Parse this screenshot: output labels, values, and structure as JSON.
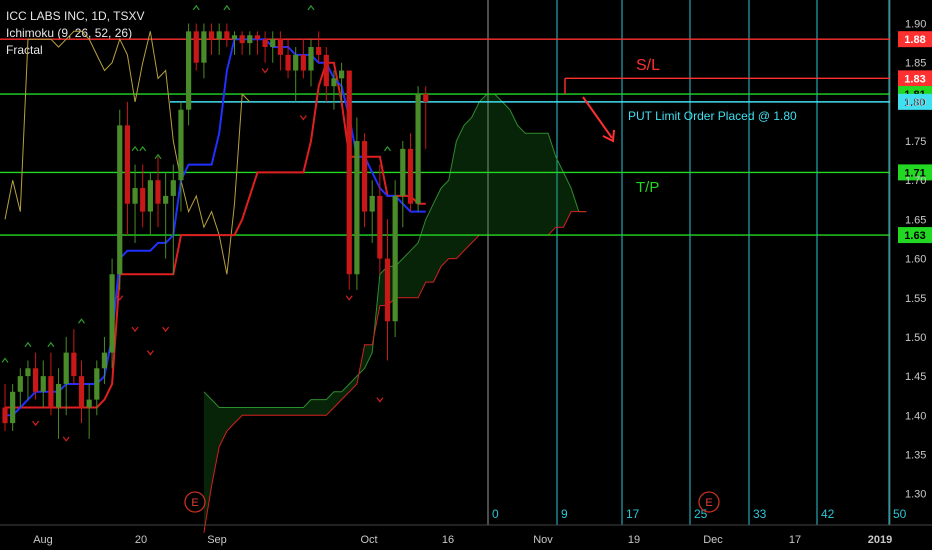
{
  "chart_data": {
    "type": "candlestick",
    "symbol_line": "ICC LABS INC, 1D, TSXV",
    "indicators": [
      "Ichimoku (9, 26, 52, 26)",
      "Fractal"
    ],
    "y_range": [
      1.26,
      1.93
    ],
    "y_ticks": [
      {
        "v": 1.9,
        "label": "1.90"
      },
      {
        "v": 1.85,
        "label": "1.85"
      },
      {
        "v": 1.8,
        "label": "1.80"
      },
      {
        "v": 1.75,
        "label": "1.75"
      },
      {
        "v": 1.7,
        "label": "1.70"
      },
      {
        "v": 1.65,
        "label": "1.65"
      },
      {
        "v": 1.6,
        "label": "1.60"
      },
      {
        "v": 1.55,
        "label": "1.55"
      },
      {
        "v": 1.5,
        "label": "1.50"
      },
      {
        "v": 1.45,
        "label": "1.45"
      },
      {
        "v": 1.4,
        "label": "1.40"
      },
      {
        "v": 1.35,
        "label": "1.35"
      },
      {
        "v": 1.3,
        "label": "1.30"
      }
    ],
    "x_labels": [
      "Aug",
      "20",
      "Sep",
      "Oct",
      "16",
      "Nov",
      "19",
      "Dec",
      "17",
      "2019"
    ],
    "bar_count_markers": [
      "0",
      "9",
      "17",
      "25",
      "33",
      "42",
      "50"
    ],
    "earnings_markers": [
      "E",
      "E"
    ],
    "horizontal_levels": [
      {
        "price": 1.88,
        "label": "1.88",
        "color": "#ff3030"
      },
      {
        "price": 1.83,
        "label": "1.83",
        "color": "#ff3030"
      },
      {
        "price": 1.81,
        "label": "1.81",
        "color": "#22d822"
      },
      {
        "price": 1.8,
        "label": "1.80",
        "color": "#40e0f0"
      },
      {
        "price": 1.71,
        "label": "1.71",
        "color": "#22d822"
      },
      {
        "price": 1.63,
        "label": "1.63",
        "color": "#22d822"
      }
    ],
    "annotations": [
      {
        "text": "S/L",
        "color": "#ff3030"
      },
      {
        "text": "PUT Limit Order Placed @ 1.80",
        "color": "#40e0f0"
      },
      {
        "text": "T/P",
        "color": "#22d822"
      }
    ],
    "candles": [
      {
        "o": 1.41,
        "h": 1.44,
        "l": 1.38,
        "c": 1.39
      },
      {
        "o": 1.39,
        "h": 1.44,
        "l": 1.38,
        "c": 1.43
      },
      {
        "o": 1.43,
        "h": 1.46,
        "l": 1.41,
        "c": 1.45
      },
      {
        "o": 1.45,
        "h": 1.47,
        "l": 1.42,
        "c": 1.46
      },
      {
        "o": 1.46,
        "h": 1.48,
        "l": 1.42,
        "c": 1.43
      },
      {
        "o": 1.43,
        "h": 1.47,
        "l": 1.41,
        "c": 1.45
      },
      {
        "o": 1.45,
        "h": 1.48,
        "l": 1.4,
        "c": 1.41
      },
      {
        "o": 1.41,
        "h": 1.46,
        "l": 1.37,
        "c": 1.44
      },
      {
        "o": 1.44,
        "h": 1.5,
        "l": 1.4,
        "c": 1.48
      },
      {
        "o": 1.48,
        "h": 1.51,
        "l": 1.44,
        "c": 1.45
      },
      {
        "o": 1.45,
        "h": 1.47,
        "l": 1.39,
        "c": 1.41
      },
      {
        "o": 1.41,
        "h": 1.44,
        "l": 1.37,
        "c": 1.42
      },
      {
        "o": 1.42,
        "h": 1.47,
        "l": 1.4,
        "c": 1.46
      },
      {
        "o": 1.46,
        "h": 1.5,
        "l": 1.44,
        "c": 1.48
      },
      {
        "o": 1.48,
        "h": 1.6,
        "l": 1.46,
        "c": 1.58
      },
      {
        "o": 1.58,
        "h": 1.79,
        "l": 1.56,
        "c": 1.77
      },
      {
        "o": 1.77,
        "h": 1.8,
        "l": 1.63,
        "c": 1.67
      },
      {
        "o": 1.67,
        "h": 1.72,
        "l": 1.62,
        "c": 1.69
      },
      {
        "o": 1.69,
        "h": 1.72,
        "l": 1.64,
        "c": 1.66
      },
      {
        "o": 1.66,
        "h": 1.71,
        "l": 1.63,
        "c": 1.7
      },
      {
        "o": 1.7,
        "h": 1.73,
        "l": 1.64,
        "c": 1.67
      },
      {
        "o": 1.67,
        "h": 1.71,
        "l": 1.6,
        "c": 1.68
      },
      {
        "o": 1.68,
        "h": 1.72,
        "l": 1.58,
        "c": 1.7
      },
      {
        "o": 1.7,
        "h": 1.8,
        "l": 1.66,
        "c": 1.79
      },
      {
        "o": 1.79,
        "h": 1.9,
        "l": 1.77,
        "c": 1.89
      },
      {
        "o": 1.89,
        "h": 1.9,
        "l": 1.84,
        "c": 1.85
      },
      {
        "o": 1.85,
        "h": 1.9,
        "l": 1.83,
        "c": 1.89
      },
      {
        "o": 1.89,
        "h": 1.9,
        "l": 1.86,
        "c": 1.88
      },
      {
        "o": 1.88,
        "h": 1.9,
        "l": 1.86,
        "c": 1.89
      },
      {
        "o": 1.89,
        "h": 1.9,
        "l": 1.87,
        "c": 1.88
      },
      {
        "o": 1.88,
        "h": 1.89,
        "l": 1.86,
        "c": 1.885
      },
      {
        "o": 1.885,
        "h": 1.89,
        "l": 1.86,
        "c": 1.875
      },
      {
        "o": 1.875,
        "h": 1.89,
        "l": 1.86,
        "c": 1.885
      },
      {
        "o": 1.885,
        "h": 1.89,
        "l": 1.86,
        "c": 1.88
      },
      {
        "o": 1.88,
        "h": 1.89,
        "l": 1.85,
        "c": 1.87
      },
      {
        "o": 1.87,
        "h": 1.89,
        "l": 1.85,
        "c": 1.88
      },
      {
        "o": 1.88,
        "h": 1.89,
        "l": 1.84,
        "c": 1.86
      },
      {
        "o": 1.86,
        "h": 1.88,
        "l": 1.83,
        "c": 1.84
      },
      {
        "o": 1.84,
        "h": 1.87,
        "l": 1.8,
        "c": 1.86
      },
      {
        "o": 1.86,
        "h": 1.88,
        "l": 1.83,
        "c": 1.84
      },
      {
        "o": 1.84,
        "h": 1.88,
        "l": 1.82,
        "c": 1.87
      },
      {
        "o": 1.87,
        "h": 1.89,
        "l": 1.85,
        "c": 1.86
      },
      {
        "o": 1.86,
        "h": 1.87,
        "l": 1.8,
        "c": 1.82
      },
      {
        "o": 1.82,
        "h": 1.84,
        "l": 1.79,
        "c": 1.83
      },
      {
        "o": 1.83,
        "h": 1.85,
        "l": 1.8,
        "c": 1.84
      },
      {
        "o": 1.84,
        "h": 1.84,
        "l": 1.56,
        "c": 1.58
      },
      {
        "o": 1.58,
        "h": 1.78,
        "l": 1.56,
        "c": 1.75
      },
      {
        "o": 1.75,
        "h": 1.76,
        "l": 1.64,
        "c": 1.66
      },
      {
        "o": 1.66,
        "h": 1.7,
        "l": 1.62,
        "c": 1.68
      },
      {
        "o": 1.68,
        "h": 1.72,
        "l": 1.58,
        "c": 1.6
      },
      {
        "o": 1.6,
        "h": 1.65,
        "l": 1.47,
        "c": 1.52
      },
      {
        "o": 1.52,
        "h": 1.7,
        "l": 1.5,
        "c": 1.68
      },
      {
        "o": 1.68,
        "h": 1.75,
        "l": 1.64,
        "c": 1.74
      },
      {
        "o": 1.74,
        "h": 1.76,
        "l": 1.66,
        "c": 1.67
      },
      {
        "o": 1.67,
        "h": 1.82,
        "l": 1.66,
        "c": 1.81
      },
      {
        "o": 1.81,
        "h": 1.82,
        "l": 1.74,
        "c": 1.8
      }
    ],
    "tenkan": [
      1.4,
      1.4,
      1.41,
      1.42,
      1.43,
      1.43,
      1.43,
      1.43,
      1.44,
      1.44,
      1.44,
      1.44,
      1.44,
      1.45,
      1.5,
      1.6,
      1.61,
      1.61,
      1.61,
      1.61,
      1.62,
      1.62,
      1.63,
      1.7,
      1.72,
      1.72,
      1.72,
      1.72,
      1.76,
      1.84,
      1.88,
      1.88,
      1.88,
      1.88,
      1.88,
      1.87,
      1.87,
      1.87,
      1.86,
      1.86,
      1.86,
      1.85,
      1.85,
      1.83,
      1.82,
      1.78,
      1.73,
      1.73,
      1.71,
      1.69,
      1.68,
      1.68,
      1.67,
      1.66,
      1.66,
      1.66
    ],
    "kijun": [
      1.41,
      1.41,
      1.41,
      1.41,
      1.41,
      1.41,
      1.41,
      1.41,
      1.41,
      1.41,
      1.41,
      1.41,
      1.41,
      1.42,
      1.44,
      1.58,
      1.58,
      1.58,
      1.58,
      1.58,
      1.58,
      1.58,
      1.58,
      1.63,
      1.63,
      1.63,
      1.63,
      1.63,
      1.63,
      1.63,
      1.63,
      1.65,
      1.68,
      1.71,
      1.71,
      1.71,
      1.71,
      1.71,
      1.71,
      1.71,
      1.75,
      1.82,
      1.85,
      1.85,
      1.8,
      1.73,
      1.73,
      1.73,
      1.73,
      1.73,
      1.68,
      1.68,
      1.68,
      1.68,
      1.67,
      1.67
    ],
    "chikou": [
      1.65,
      1.7,
      1.66,
      1.88,
      1.88,
      1.88,
      1.88,
      1.87,
      1.88,
      1.89,
      1.89,
      1.88,
      1.86,
      1.84,
      1.85,
      1.88,
      1.86,
      1.8,
      1.85,
      1.89,
      1.83,
      1.84,
      1.75,
      1.7,
      1.66,
      1.68,
      1.64,
      1.66,
      1.63,
      1.58,
      1.67,
      1.81,
      1.8
    ],
    "senkou_a": [
      1.43,
      1.42,
      1.41,
      1.41,
      1.41,
      1.41,
      1.41,
      1.41,
      1.41,
      1.41,
      1.41,
      1.41,
      1.41,
      1.41,
      1.42,
      1.42,
      1.42,
      1.43,
      1.43,
      1.44,
      1.45,
      1.46,
      1.48,
      1.58,
      1.59,
      1.59,
      1.6,
      1.61,
      1.62,
      1.65,
      1.67,
      1.69,
      1.7,
      1.75,
      1.77,
      1.78,
      1.8,
      1.81,
      1.81,
      1.8,
      1.79,
      1.77,
      1.76,
      1.76,
      1.76,
      1.76,
      1.73,
      1.71,
      1.69,
      1.66,
      1.66
    ],
    "senkou_b": [
      1.25,
      1.31,
      1.36,
      1.38,
      1.39,
      1.4,
      1.4,
      1.4,
      1.4,
      1.4,
      1.4,
      1.4,
      1.4,
      1.4,
      1.4,
      1.4,
      1.4,
      1.41,
      1.42,
      1.43,
      1.44,
      1.49,
      1.49,
      1.54,
      1.54,
      1.55,
      1.55,
      1.55,
      1.55,
      1.57,
      1.57,
      1.59,
      1.6,
      1.6,
      1.61,
      1.62,
      1.63,
      1.63,
      1.63,
      1.63,
      1.63,
      1.63,
      1.63,
      1.63,
      1.63,
      1.63,
      1.64,
      1.64,
      1.66,
      1.66,
      1.66
    ],
    "fractals_up": [
      [
        0,
        1.47
      ],
      [
        3,
        1.49
      ],
      [
        6,
        1.49
      ],
      [
        10,
        1.52
      ],
      [
        17,
        1.74
      ],
      [
        18,
        1.74
      ],
      [
        20,
        1.73
      ],
      [
        25,
        1.92
      ],
      [
        29,
        1.92
      ],
      [
        40,
        1.92
      ],
      [
        50,
        1.74
      ]
    ],
    "fractals_down": [
      [
        4,
        1.39
      ],
      [
        8,
        1.37
      ],
      [
        15,
        1.55
      ],
      [
        17,
        1.51
      ],
      [
        19,
        1.48
      ],
      [
        21,
        1.51
      ],
      [
        34,
        1.84
      ],
      [
        39,
        1.78
      ],
      [
        45,
        1.55
      ],
      [
        49,
        1.42
      ]
    ]
  }
}
